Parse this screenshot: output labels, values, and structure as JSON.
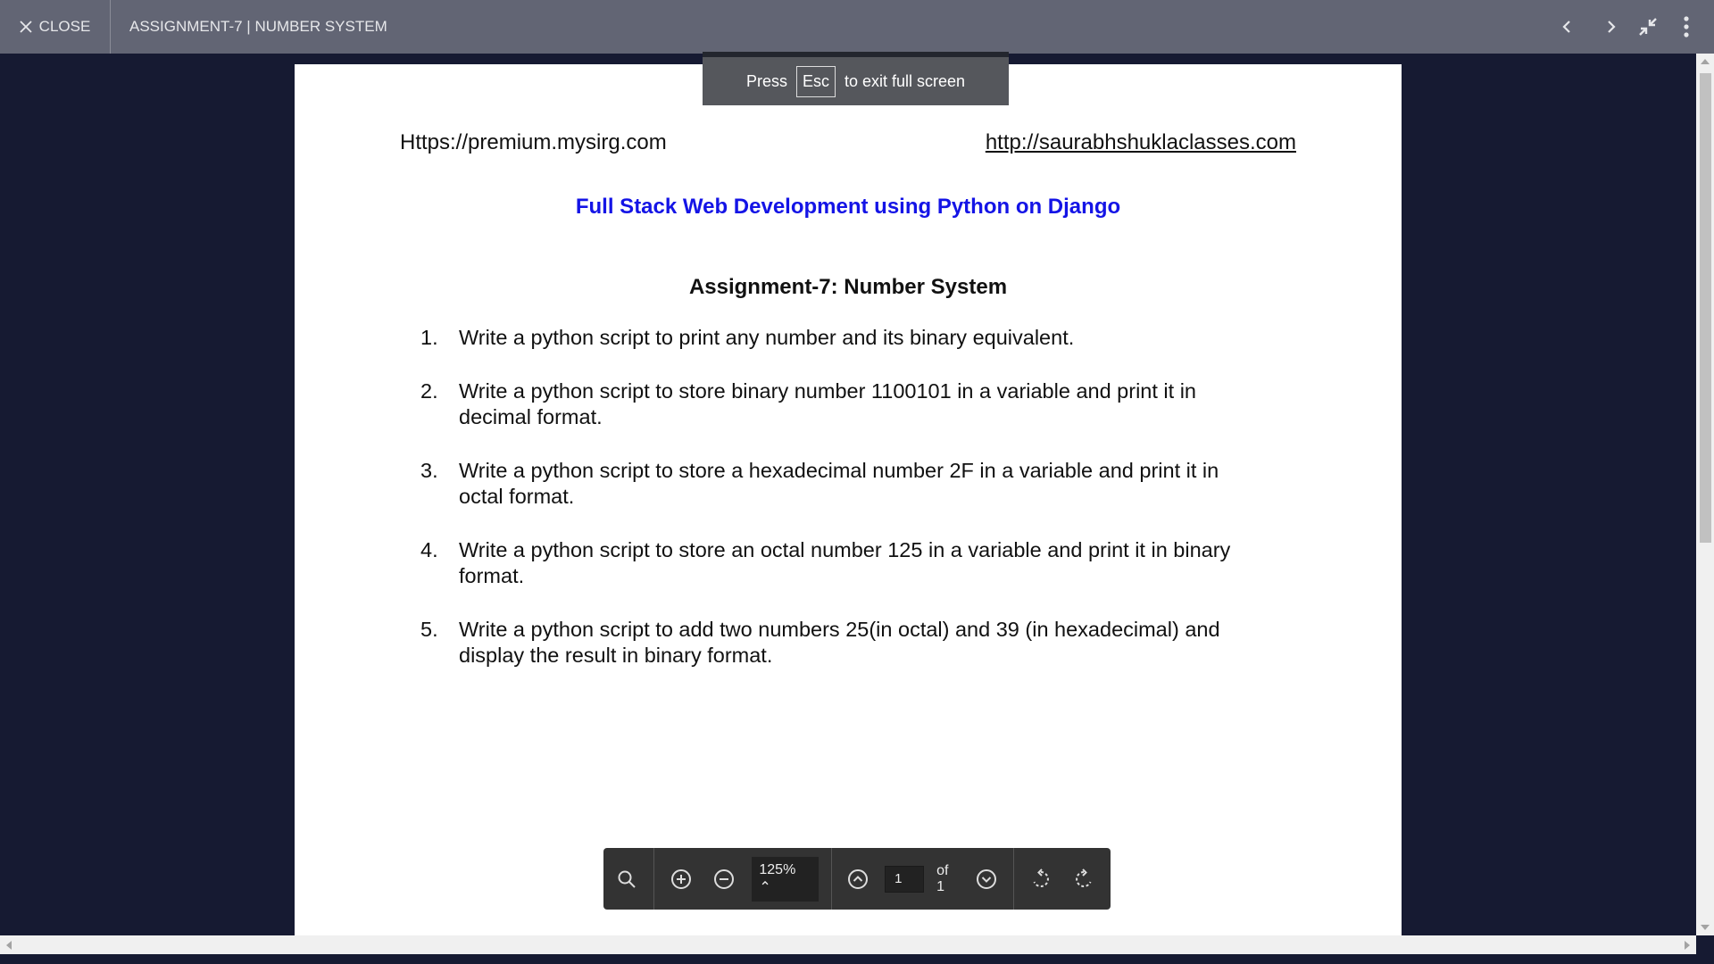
{
  "topbar": {
    "close_label": "CLOSE",
    "title": "ASSIGNMENT-7 | NUMBER SYSTEM",
    "icons": [
      "chevron-left-icon",
      "chevron-right-icon",
      "exit-fullscreen-icon",
      "more-vertical-icon"
    ]
  },
  "toast": {
    "press": "Press",
    "key": "Esc",
    "rest": "to exit full screen"
  },
  "document": {
    "header_left": "Https://premium.mysirg.com",
    "header_right": "http://saurabhshuklaclasses.com",
    "course_title": "Full Stack Web Development using Python on Django",
    "course_title_color": "#1414e6",
    "assignment_title": "Assignment-7: Number System",
    "items": [
      {
        "num": "1.",
        "text": "Write a python script to print any number and its binary equivalent."
      },
      {
        "num": "2.",
        "text": "Write a python script to store binary number 1100101 in a variable and print it in decimal format."
      },
      {
        "num": "3.",
        "text": "Write a python script to store a hexadecimal number 2F in a variable and print it in octal format."
      },
      {
        "num": "4.",
        "text": "Write a python script to store an octal number 125 in a variable and print it in binary format."
      },
      {
        "num": "5.",
        "text": "Write a python script to add two numbers 25(in octal) and 39 (in hexadecimal) and display the result in binary format."
      }
    ]
  },
  "toolbar": {
    "zoom": "125%",
    "page": "1",
    "of": "of 1"
  }
}
